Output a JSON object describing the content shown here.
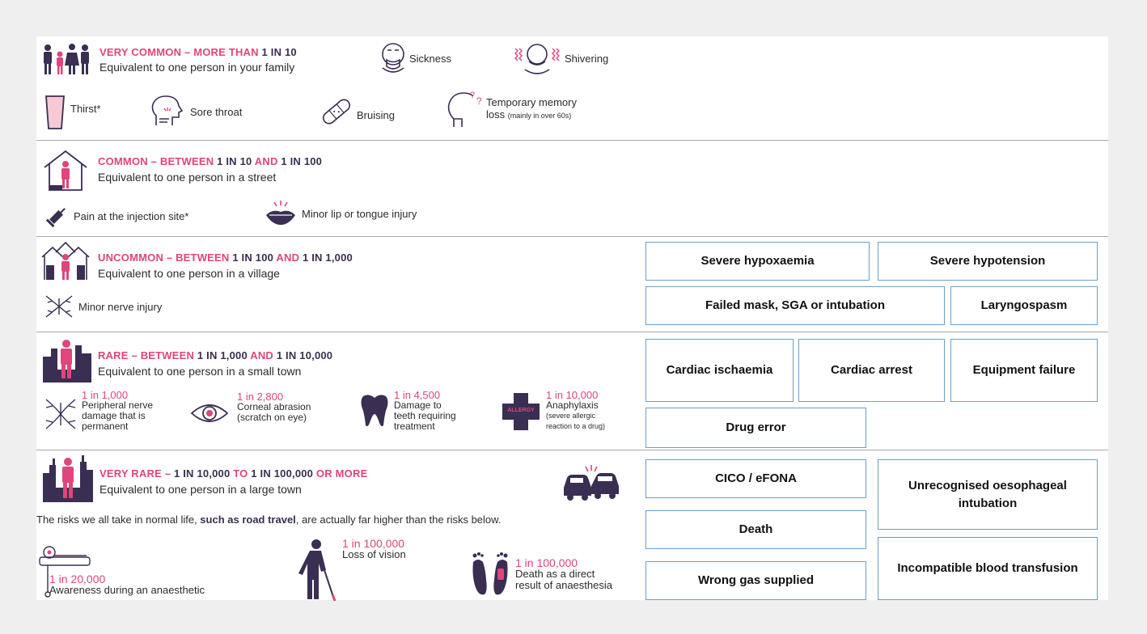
{
  "sections": {
    "very_common": {
      "title_a": "VERY COMMON – MORE THAN ",
      "title_b": "1 IN 10",
      "subtitle": "Equivalent to one person in your family",
      "items": [
        "Sickness",
        "Shivering",
        "Thirst*",
        "Sore throat",
        "Bruising"
      ],
      "memory_main": "Temporary memory",
      "memory_line2": "loss",
      "memory_small": "(mainly in over 60s)"
    },
    "common": {
      "title_a": "COMMON – BETWEEN ",
      "title_b": "1 IN 10",
      "title_c": " AND ",
      "title_d": "1 IN 100",
      "subtitle": "Equivalent to one person in a street",
      "items": [
        "Pain at the injection site*",
        "Minor lip or tongue injury"
      ]
    },
    "uncommon": {
      "title_a": "UNCOMMON – BETWEEN ",
      "title_b": "1 IN 100",
      "title_c": " AND ",
      "title_d": "1 IN 1,000",
      "subtitle": "Equivalent to one person in a village",
      "items": [
        "Minor nerve injury"
      ]
    },
    "rare": {
      "title_a": "RARE – BETWEEN ",
      "title_b": "1 IN 1,000",
      "title_c": " AND ",
      "title_d": "1 IN 10,000",
      "subtitle": "Equivalent to one person in a small town",
      "risks": [
        {
          "rate": "1 in 1,000",
          "l1": "Peripheral nerve",
          "l2": "damage that is",
          "l3": "permanent"
        },
        {
          "rate": "1 in 2,800",
          "l1": "Corneal abrasion",
          "l2": "(scratch on eye)",
          "l3": ""
        },
        {
          "rate": "1 in 4,500",
          "l1": "Damage to",
          "l2": "teeth requiring",
          "l3": "treatment"
        },
        {
          "rate": "1 in 10,000",
          "l1": "Anaphylaxis",
          "l2": "(severe allergic",
          "l3": "reaction to a drug)"
        }
      ],
      "allergy_label": "ALLERGY"
    },
    "very_rare": {
      "title_a": "VERY RARE – ",
      "title_b": "1 IN 10,000",
      "title_c": " TO ",
      "title_d": "1 IN 100,000",
      "title_e": " OR MORE",
      "subtitle": "Equivalent to one person in a large town",
      "note_a": "The risks we all take in normal life, ",
      "note_b": "such as road travel",
      "note_c": ", are actually far higher than the risks below.",
      "risks": [
        {
          "rate": "1 in 20,000",
          "l1": "Awareness during an anaesthetic",
          "l2": ""
        },
        {
          "rate": "1 in 100,000",
          "l1": "Loss of vision",
          "l2": ""
        },
        {
          "rate": "1 in 100,000",
          "l1": "Death as a direct",
          "l2": "result of anaesthesia"
        }
      ]
    }
  },
  "boxes": {
    "uncommon": [
      "Severe hypoxaemia",
      "Severe hypotension",
      "Failed mask, SGA or intubation",
      "Laryngospasm"
    ],
    "rare": [
      "Cardiac ischaemia",
      "Cardiac arrest",
      "Equipment failure",
      "Drug error"
    ],
    "very_rare": [
      "CICO / eFONA",
      "Unrecognised oesophageal intubation",
      "Death",
      "Incompatible blood transfusion",
      "Wrong gas supplied"
    ]
  },
  "colors": {
    "pink": "#e0457b",
    "purple": "#3a2e52",
    "box_border": "#6d9ec6"
  }
}
